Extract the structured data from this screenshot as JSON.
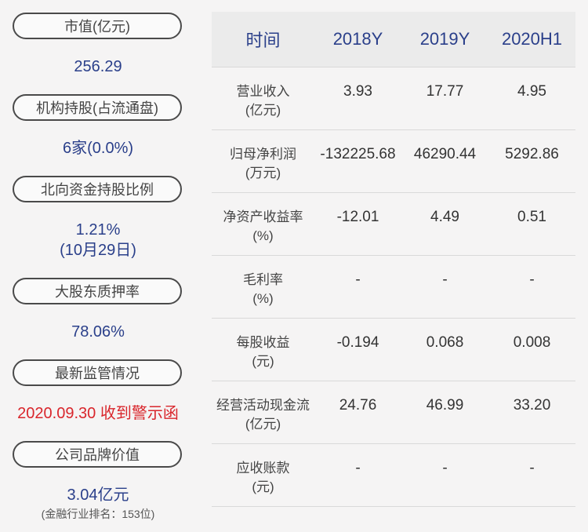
{
  "left": {
    "items": [
      {
        "label": "市值(亿元)",
        "value": "256.29"
      },
      {
        "label": "机构持股(占流通盘)",
        "value": "6家(0.0%)"
      },
      {
        "label": "北向资金持股比例",
        "value": "1.21%",
        "value2": "(10月29日)"
      },
      {
        "label": "大股东质押率",
        "value": "78.06%"
      },
      {
        "label": "最新监管情况",
        "value": "2020.09.30 收到警示函"
      },
      {
        "label": "公司品牌价值",
        "value": "3.04亿元",
        "note": "(金融行业排名：153位)"
      }
    ]
  },
  "table": {
    "headers": [
      "时间",
      "2018Y",
      "2019Y",
      "2020H1"
    ],
    "rows": [
      {
        "label": "营业收入",
        "unit": "(亿元)",
        "values": [
          "3.93",
          "17.77",
          "4.95"
        ]
      },
      {
        "label": "归母净利润",
        "unit": "(万元)",
        "values": [
          "-132225.68",
          "46290.44",
          "5292.86"
        ]
      },
      {
        "label": "净资产收益率",
        "unit": "(%)",
        "values": [
          "-12.01",
          "4.49",
          "0.51"
        ]
      },
      {
        "label": "毛利率",
        "unit": "(%)",
        "values": [
          "-",
          "-",
          "-"
        ]
      },
      {
        "label": "每股收益",
        "unit": "(元)",
        "values": [
          "-0.194",
          "0.068",
          "0.008"
        ]
      },
      {
        "label": "经营活动现金流",
        "unit": "(亿元)",
        "values": [
          "24.76",
          "46.99",
          "33.20"
        ]
      },
      {
        "label": "应收账款",
        "unit": "(元)",
        "values": [
          "-",
          "-",
          "-"
        ]
      }
    ]
  },
  "colors": {
    "accent": "#2a3f8a",
    "alert": "#d9262c"
  }
}
